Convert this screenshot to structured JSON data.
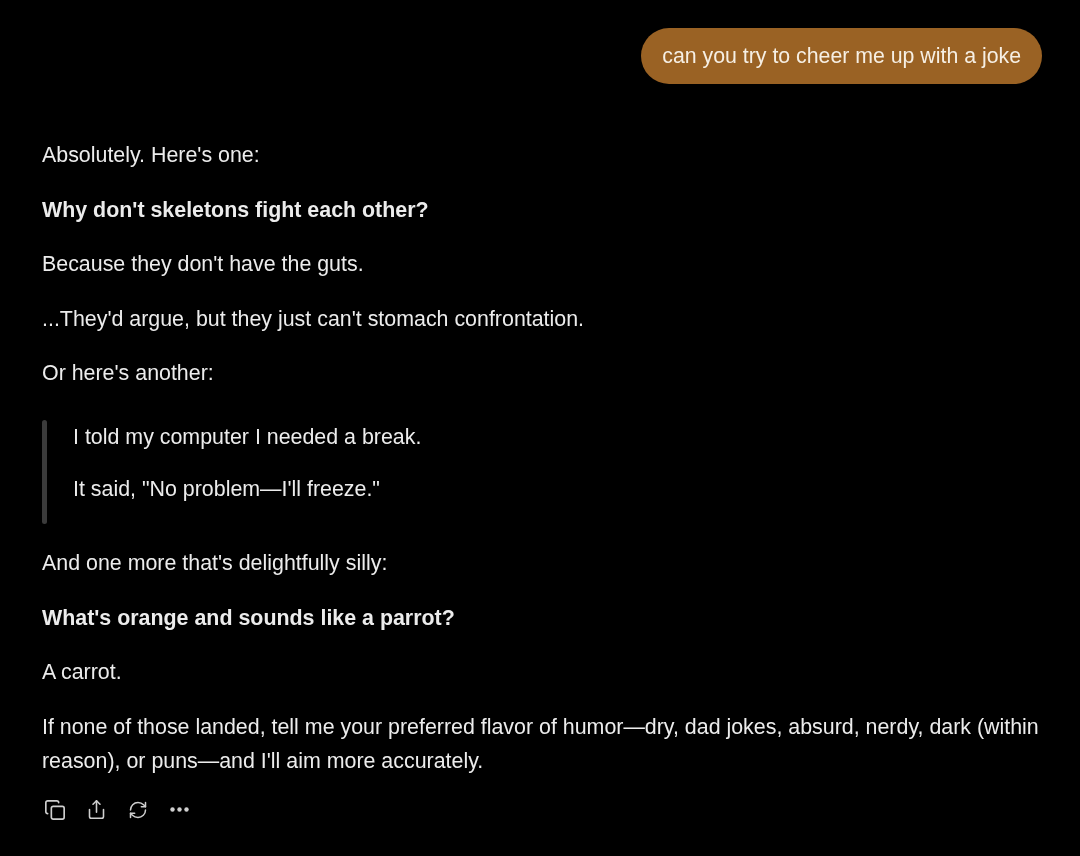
{
  "user_message": {
    "text": "can you try to cheer me up with a joke"
  },
  "response": {
    "blocks": [
      {
        "kind": "paragraph",
        "text": "Absolutely. Here's one:"
      },
      {
        "kind": "bold",
        "text": "Why don't skeletons fight each other?"
      },
      {
        "kind": "paragraph",
        "text": "Because they don't have the guts."
      },
      {
        "kind": "paragraph",
        "text": "...They'd argue, but they just can't stomach confrontation."
      },
      {
        "kind": "paragraph",
        "text": "Or here's another:"
      },
      {
        "kind": "quote",
        "lines": [
          "I told my computer I needed a break.",
          "It said, \"No problem—I'll freeze.\""
        ]
      },
      {
        "kind": "paragraph",
        "text": "And one more that's delightfully silly:"
      },
      {
        "kind": "bold",
        "text": "What's orange and sounds like a parrot?"
      },
      {
        "kind": "paragraph",
        "text": "A carrot."
      },
      {
        "kind": "paragraph",
        "text": "If none of those landed, tell me your preferred flavor of humor—dry, dad jokes, absurd, nerdy, dark (within reason), or puns—and I'll aim more accurately."
      }
    ]
  }
}
